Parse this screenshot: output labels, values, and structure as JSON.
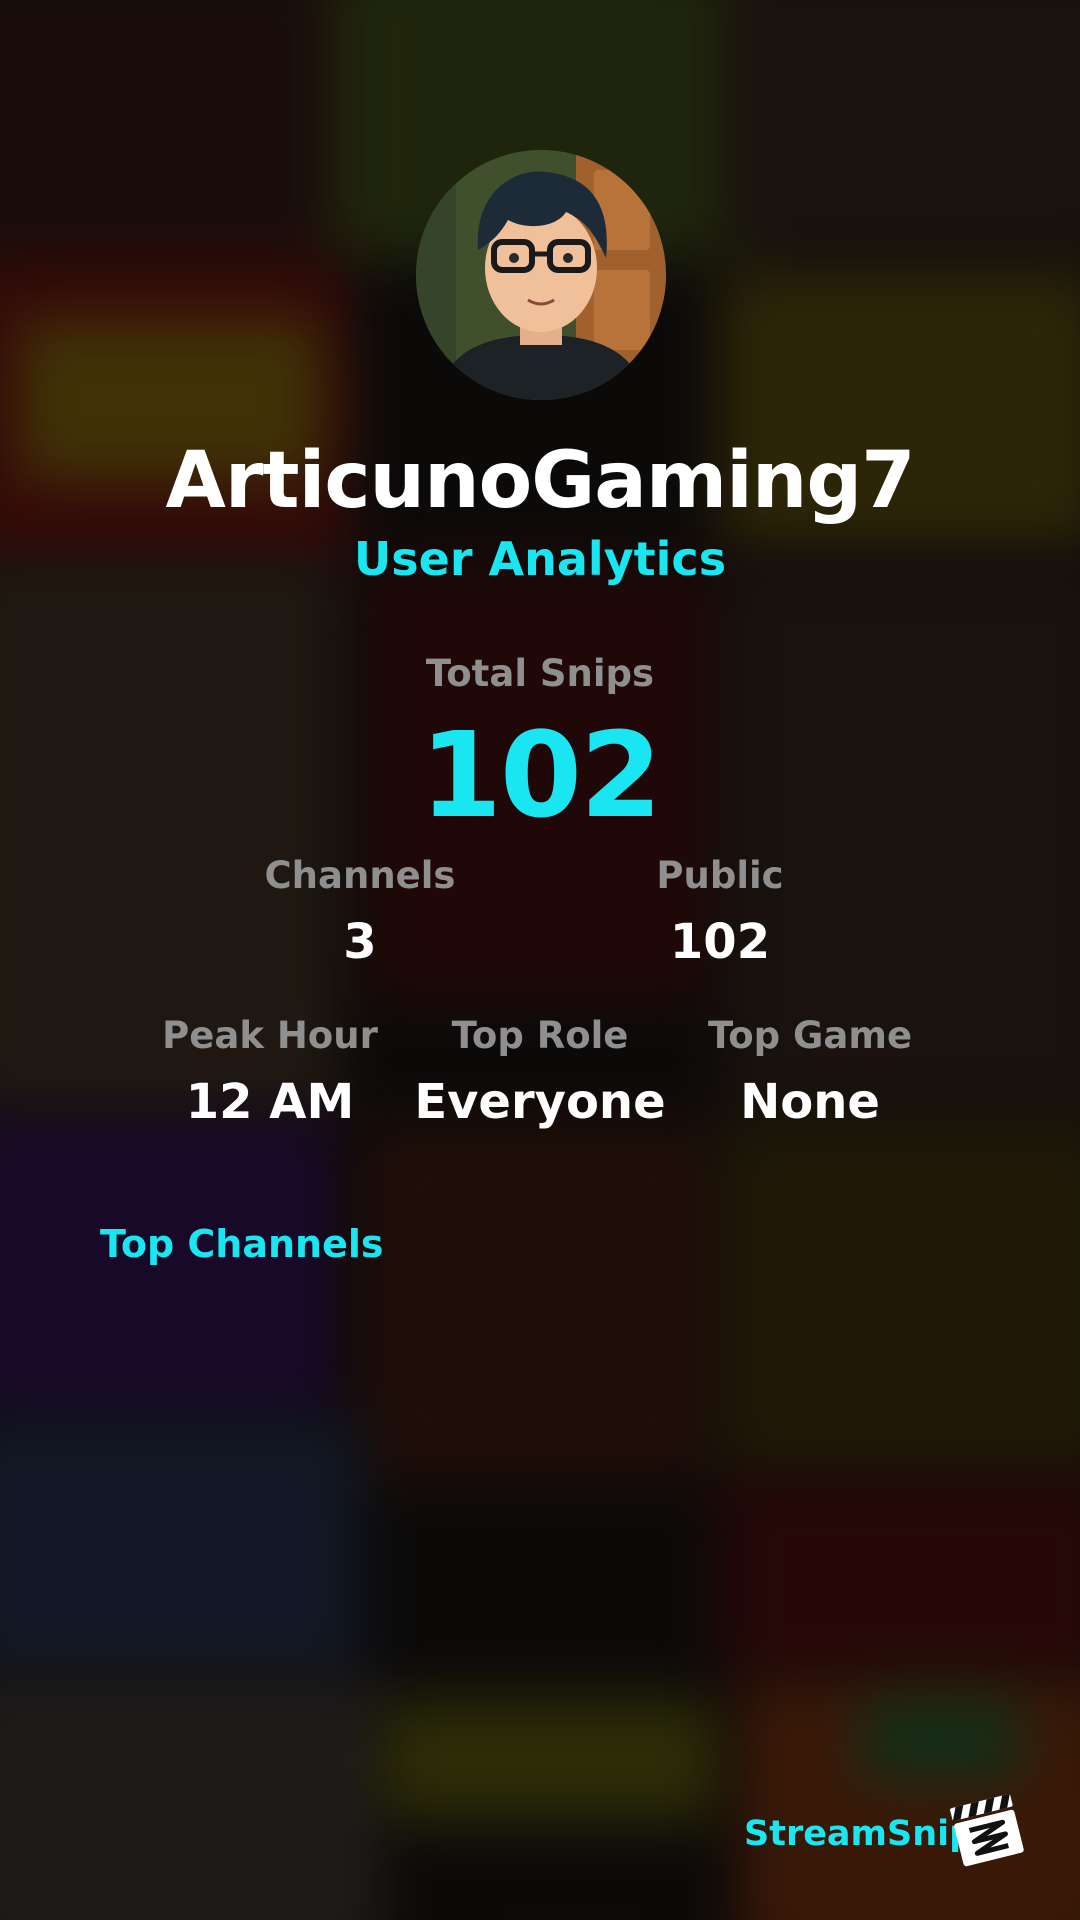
{
  "profile": {
    "username": "ArticunoGaming7",
    "subtitle": "User Analytics"
  },
  "stats": {
    "total_label": "Total Snips",
    "total_value": "102",
    "channels_label": "Channels",
    "channels_value": "3",
    "public_label": "Public",
    "public_value": "102",
    "peak_hour_label": "Peak Hour",
    "peak_hour_value": "12 AM",
    "top_role_label": "Top Role",
    "top_role_value": "Everyone",
    "top_game_label": "Top Game",
    "top_game_value": "None"
  },
  "sections": {
    "top_channels_title": "Top Channels"
  },
  "footer": {
    "brand": "StreamSnip",
    "logo_icon": "clapperboard-icon"
  },
  "colors": {
    "accent": "#19e6f0",
    "label": "#8f8f8f",
    "text": "#ffffff"
  }
}
